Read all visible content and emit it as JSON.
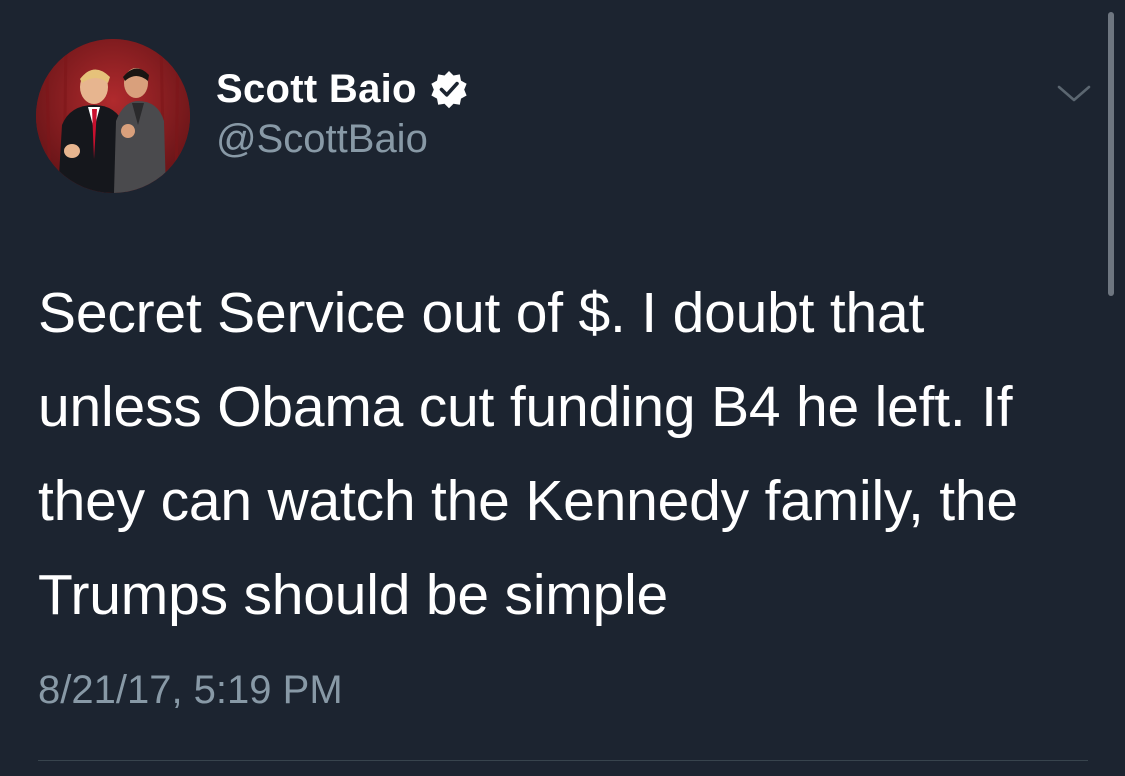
{
  "tweet": {
    "author": {
      "display_name": "Scott Baio",
      "handle": "@ScottBaio",
      "verified": true,
      "avatar_icon": "profile-photo"
    },
    "text": "Secret Service out of $. I doubt that unless Obama cut funding B4 he left. If they can watch the Kennedy family, the Trumps should be simple",
    "timestamp": "8/21/17, 5:19 PM",
    "menu_icon": "chevron-down-icon"
  },
  "colors": {
    "background": "#1c2430",
    "text_primary": "#ffffff",
    "text_secondary": "#8899a6",
    "verified_badge": "#ffffff"
  }
}
